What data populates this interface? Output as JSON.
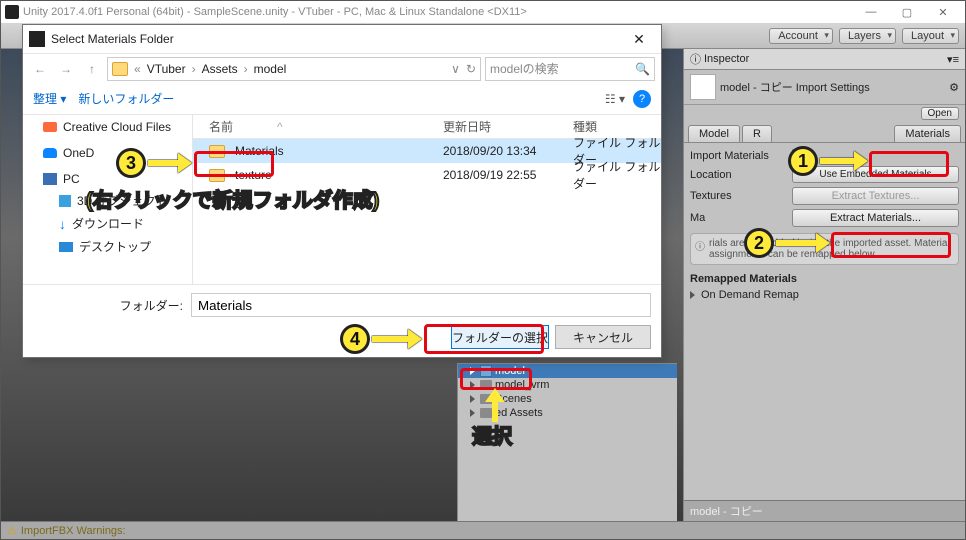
{
  "unity": {
    "title": "Unity 2017.4.0f1 Personal (64bit) - SampleScene.unity - VTuber - PC, Mac & Linux Standalone <DX11>",
    "toolbar": {
      "account": "Account",
      "layers": "Layers",
      "layout": "Layout"
    },
    "status": "ImportFBX Warnings:"
  },
  "inspector": {
    "tab": "Inspector",
    "title": "model - コピー Import Settings",
    "open": "Open",
    "tabs": {
      "model": "Model",
      "r": "R",
      "materials": "Materials"
    },
    "fields": {
      "import_materials": "Import Materials",
      "location": "Location",
      "location_value": "Use Embedded Materials",
      "textures": "Textures",
      "extract_textures": "Extract Textures...",
      "ma": "Ma",
      "extract_materials": "Extract Materials..."
    },
    "info": "rials are embedded inside the imported asset. Material assignments can be remapped below.",
    "remapped": "Remapped Materials",
    "on_demand": "On Demand Remap",
    "footer": "model - コピー"
  },
  "project": {
    "items": [
      "model",
      "model_vrm",
      "Scenes",
      "ed Assets"
    ]
  },
  "dialog": {
    "title": "Select Materials Folder",
    "breadcrumb": [
      "VTuber",
      "Assets",
      "model"
    ],
    "search_placeholder": "modelの検索",
    "toolbar": {
      "organize": "整理",
      "new_folder": "新しいフォルダー"
    },
    "columns": {
      "name": "名前",
      "date": "更新日時",
      "type": "種類"
    },
    "side": {
      "ccloud": "Creative Cloud Files",
      "onedrive": "OneD",
      "pc": "PC",
      "threeD": "3D オブジェクト",
      "download": "ダウンロード",
      "desktop": "デスクトップ"
    },
    "rows": [
      {
        "name": "Materials",
        "date": "2018/09/20 13:34",
        "type": "ファイル フォルダー"
      },
      {
        "name": "texture",
        "date": "2018/09/19 22:55",
        "type": "ファイル フォルダー"
      }
    ],
    "folder_label": "フォルダー:",
    "folder_value": "Materials",
    "select_btn": "フォルダーの選択",
    "cancel_btn": "キャンセル"
  },
  "annotations": {
    "n1": "1",
    "n2": "2",
    "n3": "3",
    "n4": "4",
    "right_click": "(右クリックで新規フォルダ作成)",
    "select": "選択"
  }
}
